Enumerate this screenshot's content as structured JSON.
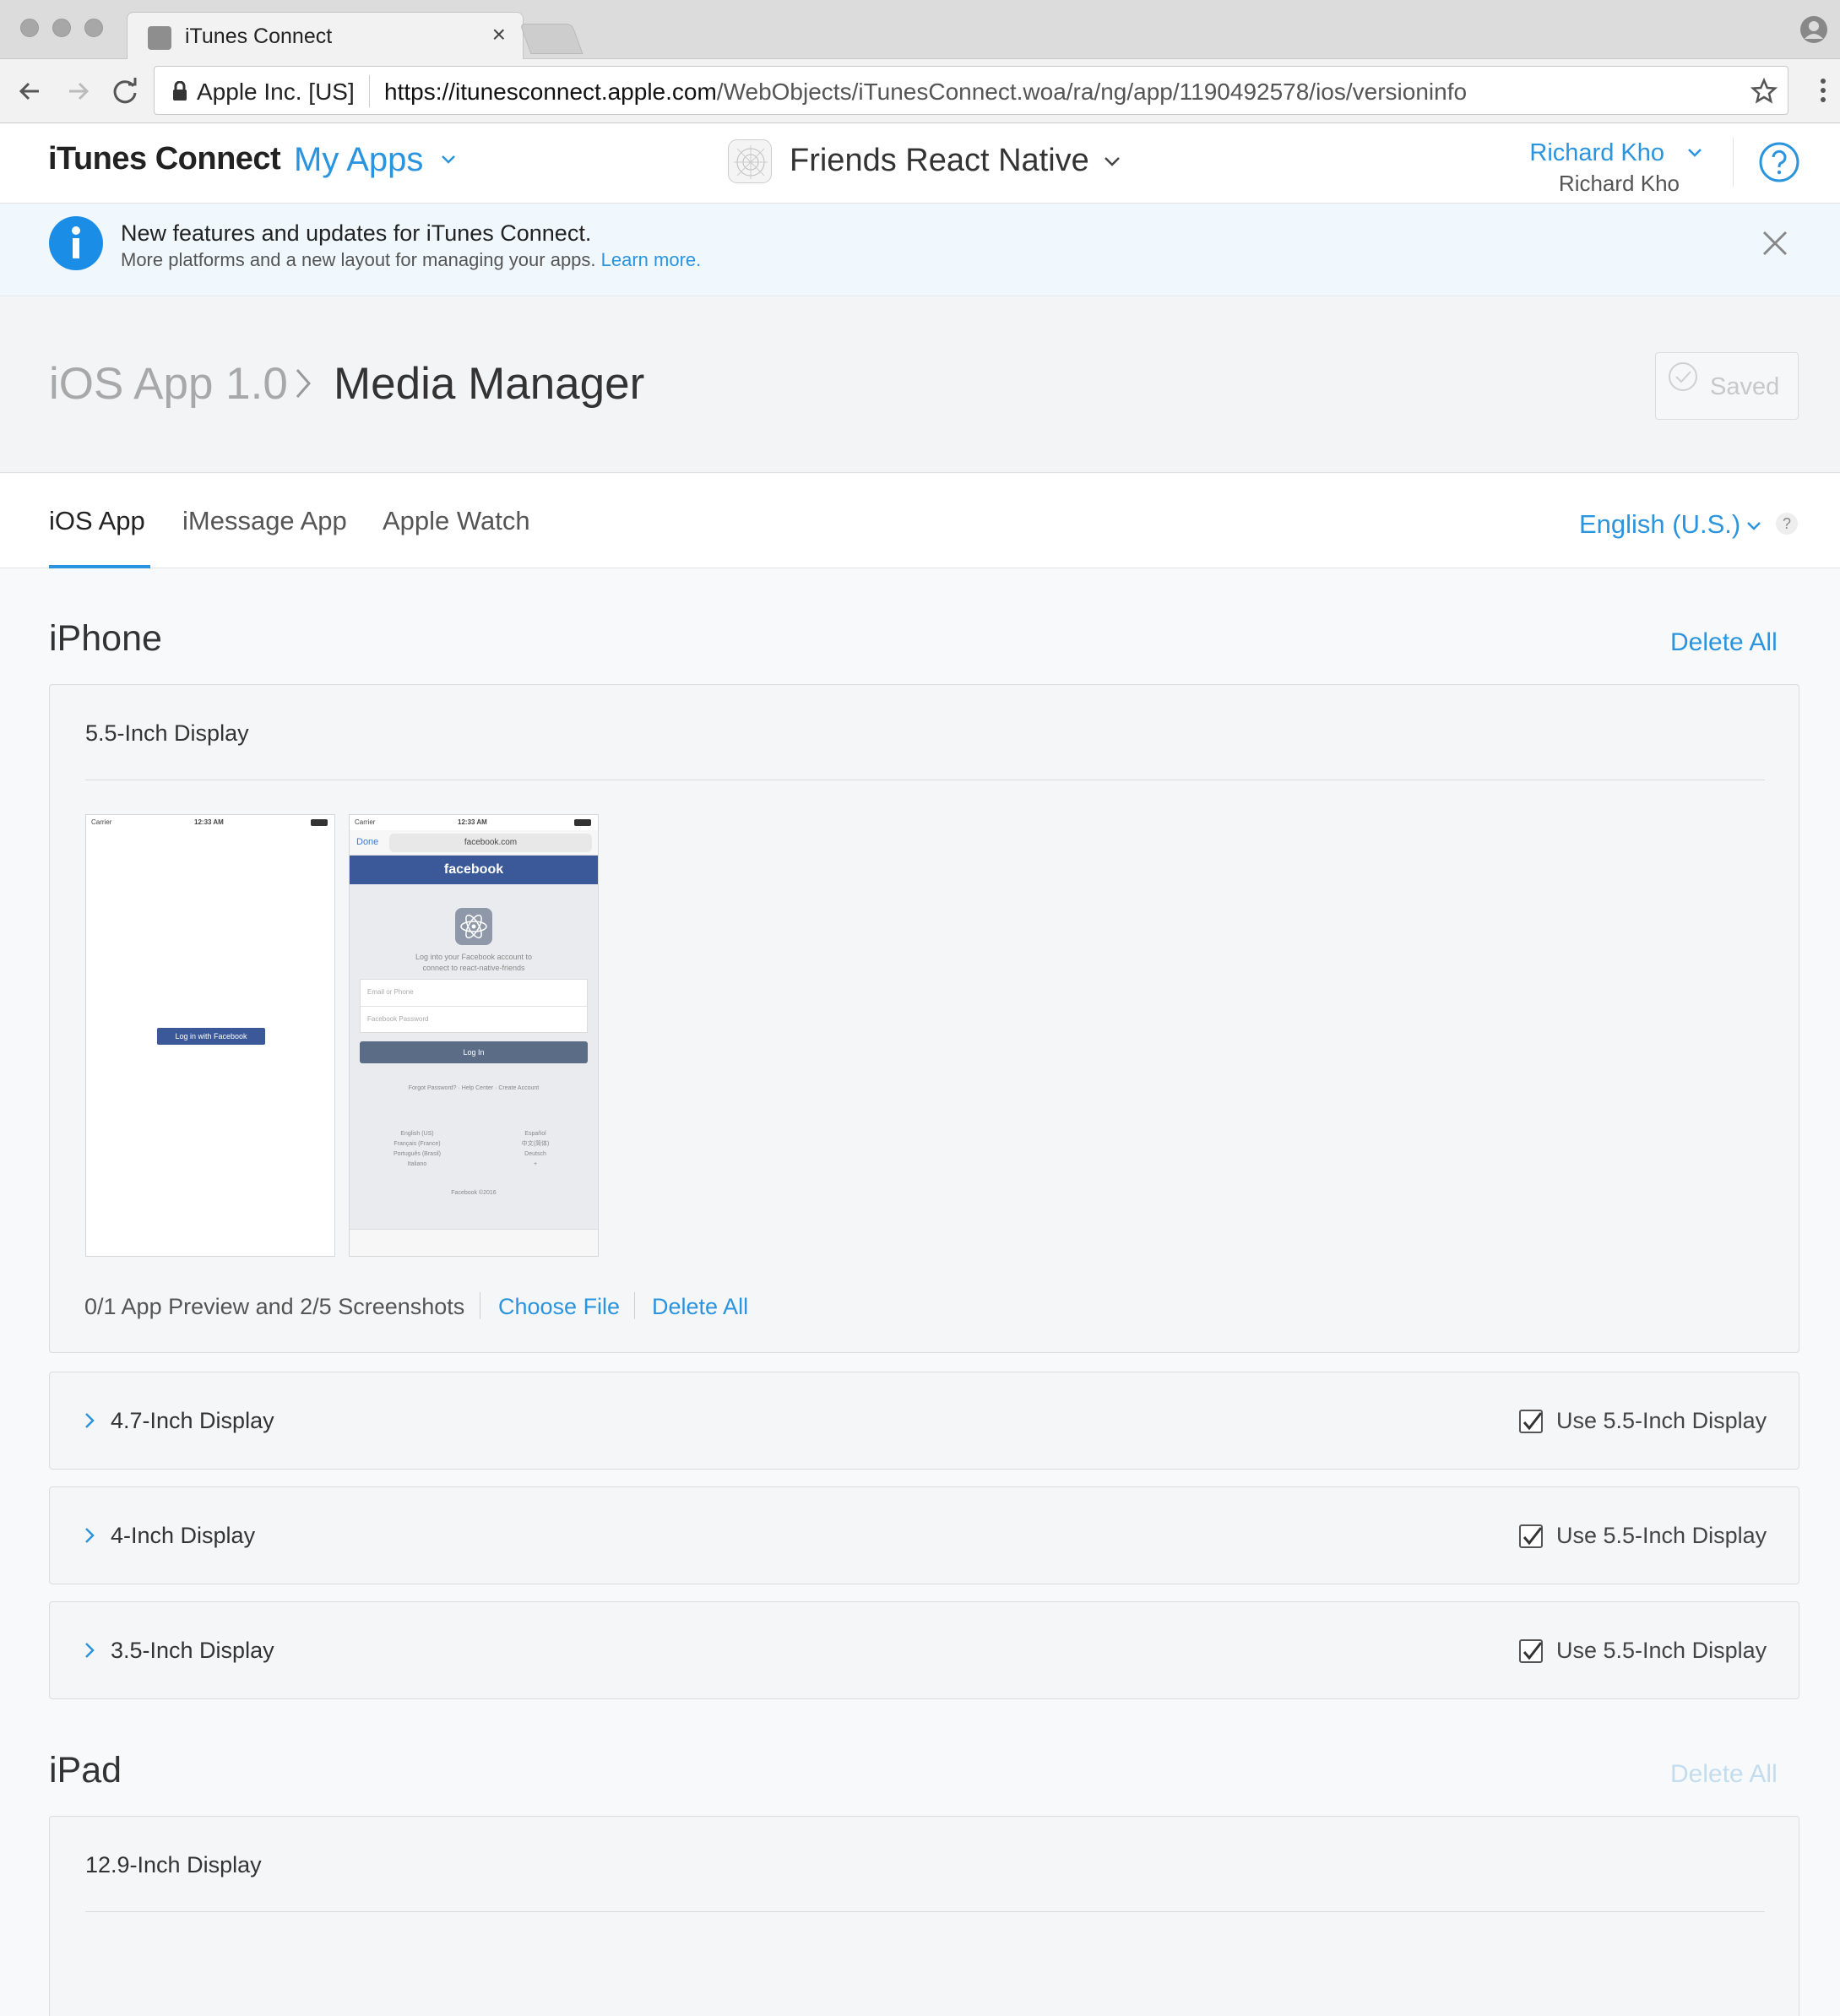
{
  "browser": {
    "tab_title": "iTunes Connect",
    "org_name": "Apple Inc. [US]",
    "url_host": "https://itunesconnect.apple.com",
    "url_path": "/WebObjects/iTunesConnect.woa/ra/ng/app/1190492578/ios/versioninfo",
    "icons": [
      "back-icon",
      "forward-icon",
      "reload-icon",
      "lock-icon",
      "star-icon",
      "menu-icon",
      "profile-icon",
      "close-icon"
    ]
  },
  "header": {
    "brand": "iTunes Connect",
    "my_apps": "My Apps",
    "app_name": "Friends React Native",
    "user_name": "Richard Kho",
    "user_sub": "Richard Kho"
  },
  "banner": {
    "title": "New features and updates for iTunes Connect.",
    "text": "More platforms and a new layout for managing your apps. ",
    "link": "Learn more."
  },
  "breadcrumb": {
    "parent": "iOS App 1.0",
    "current": "Media Manager",
    "saved_label": "Saved"
  },
  "tabs": {
    "ios": "iOS App",
    "imessage": "iMessage App",
    "watch": "Apple Watch",
    "language": "English (U.S.)",
    "help": "?"
  },
  "iphone": {
    "title": "iPhone",
    "delete_all": "Delete All",
    "display_55": {
      "title": "5.5-Inch Display",
      "meta": "0/1 App Preview and 2/5 Screenshots",
      "choose_file": "Choose File",
      "delete_all": "Delete All"
    },
    "screenshot1": {
      "carrier": "Carrier",
      "time": "12:33 AM",
      "button": "Log in with Facebook"
    },
    "screenshot2": {
      "carrier": "Carrier",
      "time": "12:33 AM",
      "done": "Done",
      "url": "facebook.com",
      "header": "facebook",
      "prompt_line1": "Log into your Facebook account to",
      "prompt_line2": "connect to react-native-friends",
      "email_placeholder": "Email or Phone",
      "password_placeholder": "Facebook Password",
      "login": "Log In",
      "links": "Forgot Password? · Help Center · Create Account",
      "lang_left": [
        "English (US)",
        "Français (France)",
        "Português (Brasil)",
        "Italiano"
      ],
      "lang_right": [
        "Español",
        "中文(简体)",
        "Deutsch",
        "+"
      ],
      "footer": "Facebook ©2016"
    },
    "collapsed_displays": [
      {
        "title": "4.7-Inch Display",
        "checkbox_label": "Use 5.5-Inch Display",
        "checked": true
      },
      {
        "title": "4-Inch Display",
        "checkbox_label": "Use 5.5-Inch Display",
        "checked": true
      },
      {
        "title": "3.5-Inch Display",
        "checkbox_label": "Use 5.5-Inch Display",
        "checked": true
      }
    ]
  },
  "ipad": {
    "title": "iPad",
    "delete_all": "Delete All",
    "display_129": {
      "title": "12.9-Inch Display"
    }
  },
  "colors": {
    "accent": "#2b94de",
    "banner_bg": "#f1f8fd",
    "facebook_blue": "#3b5998"
  }
}
